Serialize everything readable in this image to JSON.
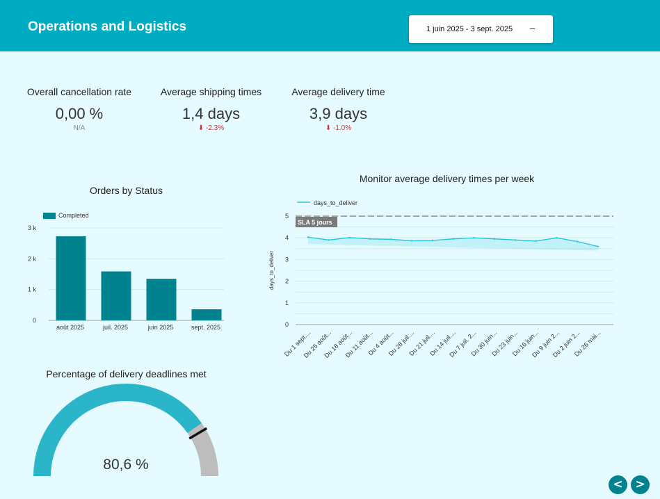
{
  "header": {
    "title": "Operations and Logistics",
    "date_range": "1 juin 2025 - 3 sept. 2025",
    "date_caret_icon": "caret-down-icon"
  },
  "kpis": [
    {
      "label": "Overall cancellation rate",
      "value": "0,00 %",
      "delta": "N/A"
    },
    {
      "label": "Average shipping times",
      "value": "1,4 days",
      "delta": "-2.3%"
    },
    {
      "label": "Average delivery time",
      "value": "3,9 days",
      "delta": "-1.0%"
    }
  ],
  "colors": {
    "header": "#00acc1",
    "background": "#e6fbff",
    "bar": "#00838f",
    "line": "#26c6da",
    "gauge_fill": "#2bb5c8",
    "gauge_rest": "#bdbdbd",
    "negative": "#d32f2f"
  },
  "chart_data": [
    {
      "type": "bar",
      "title": "Orders by Status",
      "legend": [
        "Completed"
      ],
      "legend_position": "top-left",
      "categories": [
        "août 2025",
        "juil. 2025",
        "juin 2025",
        "sept. 2025"
      ],
      "series": [
        {
          "name": "Completed",
          "values": [
            2730,
            1590,
            1350,
            360
          ]
        }
      ],
      "yticks": [
        "0",
        "1 k",
        "2 k",
        "3 k"
      ],
      "ylim": [
        0,
        3000
      ],
      "grid": true
    },
    {
      "type": "line",
      "title": "Monitor average delivery times per week",
      "legend": [
        "days_to_deliver"
      ],
      "legend_position": "top-left",
      "ylabel": "days_to_deliver",
      "categories": [
        "Du 1 sept....",
        "Du 25 août...",
        "Du 18 août...",
        "Du 11 août...",
        "Du 4 août...",
        "Du 28 juil....",
        "Du 21 juil....",
        "Du 14 juil....",
        "Du 7 juil. 2...",
        "Du 30 juin...",
        "Du 23 juin...",
        "Du 16 juin...",
        "Du 9 juin 2...",
        "Du 2 juin 2...",
        "Du 26 mai..."
      ],
      "series": [
        {
          "name": "days_to_deliver",
          "values": [
            4.03,
            3.9,
            4.01,
            3.95,
            3.93,
            3.86,
            3.88,
            3.95,
            4.0,
            3.95,
            3.9,
            3.85,
            4.0,
            3.83,
            3.6
          ]
        }
      ],
      "yticks": [
        "0",
        "1",
        "2",
        "3",
        "4",
        "5"
      ],
      "ylim": [
        0,
        5
      ],
      "reference_line": {
        "label": "SLA 5 jours",
        "value": 5
      },
      "grid": true
    },
    {
      "type": "gauge",
      "title": "Percentage of delivery deadlines met",
      "value": 80.6,
      "value_label": "80,6 %",
      "min": 0,
      "max": 100
    }
  ],
  "nav": {
    "prev": "<",
    "next": ">"
  }
}
